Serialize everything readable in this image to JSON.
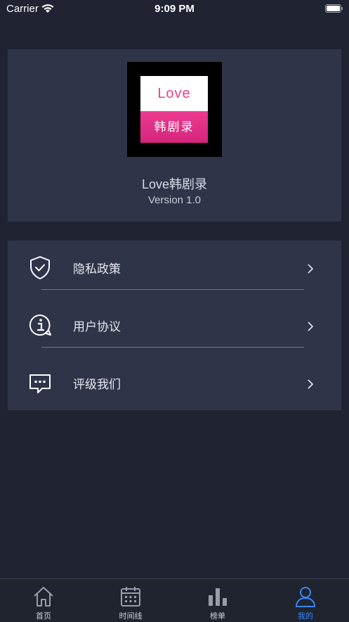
{
  "status_bar": {
    "carrier": "Carrier",
    "time": "9:09 PM"
  },
  "header": {
    "logo_top_text": "Love",
    "logo_bottom_text": "韩剧录",
    "app_name": "Love韩剧录",
    "version": "Version 1.0"
  },
  "menu": {
    "items": [
      {
        "label": "隐私政策",
        "icon": "shield-check-icon"
      },
      {
        "label": "用户协议",
        "icon": "info-bubble-icon"
      },
      {
        "label": "评级我们",
        "icon": "chat-dots-icon"
      }
    ]
  },
  "tabbar": {
    "tabs": [
      {
        "label": "首页",
        "icon": "home-icon",
        "active": false
      },
      {
        "label": "时间线",
        "icon": "calendar-icon",
        "active": false
      },
      {
        "label": "榜单",
        "icon": "bar-chart-icon",
        "active": false
      },
      {
        "label": "我的",
        "icon": "user-icon",
        "active": true
      }
    ]
  },
  "colors": {
    "background": "#1f2332",
    "card": "#2f3449",
    "accent": "#3a86ff",
    "logo_pink": "#e83f92"
  }
}
